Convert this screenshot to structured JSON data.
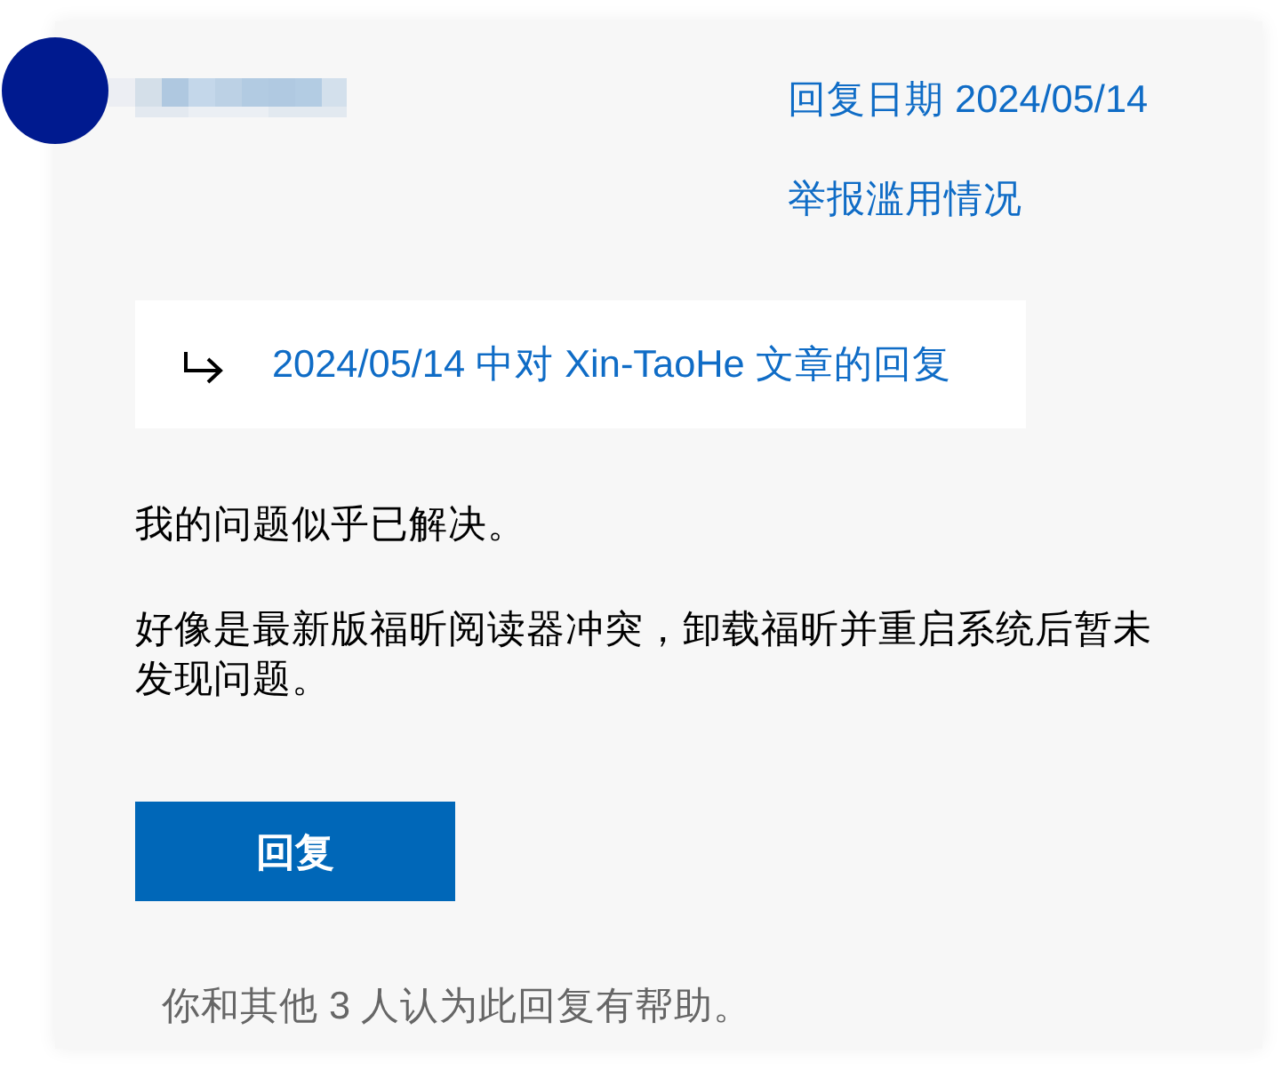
{
  "header": {
    "reply_date": "回复日期 2024/05/14",
    "report_link": "举报滥用情况"
  },
  "quote": {
    "link": "2024/05/14 中对 Xin-TaoHe 文章的回复"
  },
  "body": {
    "paragraphs": [
      "我的问题似乎已解决。",
      "好像是最新版福昕阅读器冲突，卸载福昕并重启系统后暂未发现问题。"
    ]
  },
  "reply_button": {
    "label": "回复"
  },
  "helpful": {
    "text": "你和其他 3 人认为此回复有帮助。"
  }
}
